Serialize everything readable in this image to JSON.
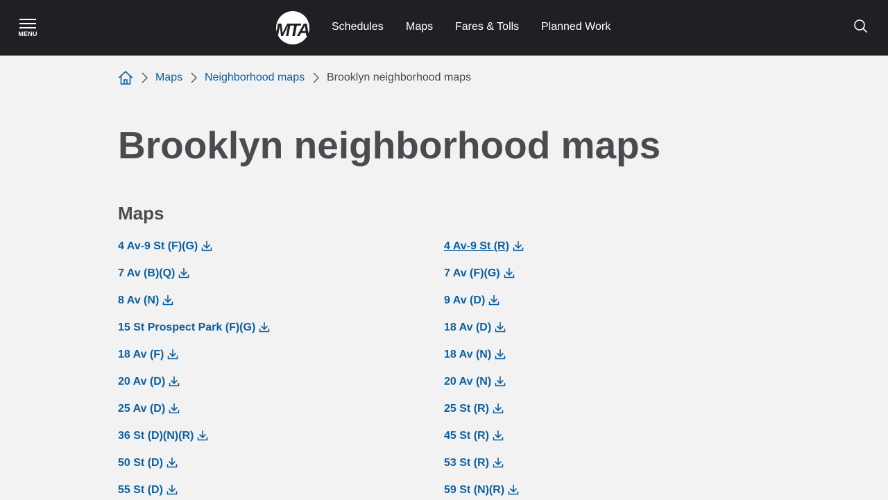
{
  "header": {
    "menu_label": "MENU",
    "logo_text": "MTA",
    "nav": [
      "Schedules",
      "Maps",
      "Fares & Tolls",
      "Planned Work"
    ],
    "colors": {
      "bar": "#1f2024",
      "text": "#ffffff"
    }
  },
  "breadcrumb": {
    "home_icon": "home-icon",
    "links": [
      "Maps",
      "Neighborhood maps"
    ],
    "current": "Brooklyn neighborhood maps"
  },
  "page": {
    "title": "Brooklyn neighborhood maps",
    "section_title": "Maps"
  },
  "maps": {
    "left": [
      "4 Av-9 St (F)(G)",
      "7 Av (B)(Q)",
      "8 Av (N)",
      "15 St Prospect Park (F)(G)",
      "18 Av (F)",
      "20 Av (D)",
      "25 Av (D)",
      "36 St (D)(N)(R)",
      "50 St (D)",
      "55 St (D)"
    ],
    "right": [
      "4 Av-9 St (R)",
      "7 Av (F)(G)",
      "9 Av (D)",
      "18 Av (D)",
      "18 Av (N)",
      "20 Av (N)",
      "25 St (R)",
      "45 St (R)",
      "53 St (R)",
      "59 St (N)(R)"
    ],
    "hovered": "4 Av-9 St (R)",
    "item_icon": "download-icon"
  },
  "colors": {
    "link": "#0b5f9f",
    "text": "#494b4e",
    "background": "#f2f2f2"
  }
}
